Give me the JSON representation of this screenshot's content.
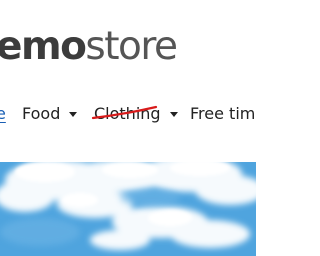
{
  "logo": {
    "bold_part": "emo",
    "light_part": "store"
  },
  "nav": {
    "items": [
      {
        "label": "e",
        "active": true,
        "has_dropdown": false
      },
      {
        "label": "Food",
        "active": false,
        "has_dropdown": true
      },
      {
        "label": "Clothing",
        "active": false,
        "has_dropdown": true,
        "struck_through": true
      },
      {
        "label": "Free time",
        "active": false,
        "has_dropdown": false
      }
    ],
    "icons": {
      "dropdown": "caret-down-icon"
    }
  },
  "hero": {
    "scene": "blue sky with white clouds",
    "colors": {
      "sky": "#4ea3dd",
      "cloud": "#ffffff"
    }
  },
  "colors": {
    "text": "#222222",
    "logo": "#3c3c3c",
    "link_active": "#1a5fb4",
    "strike": "#d81b1b"
  }
}
